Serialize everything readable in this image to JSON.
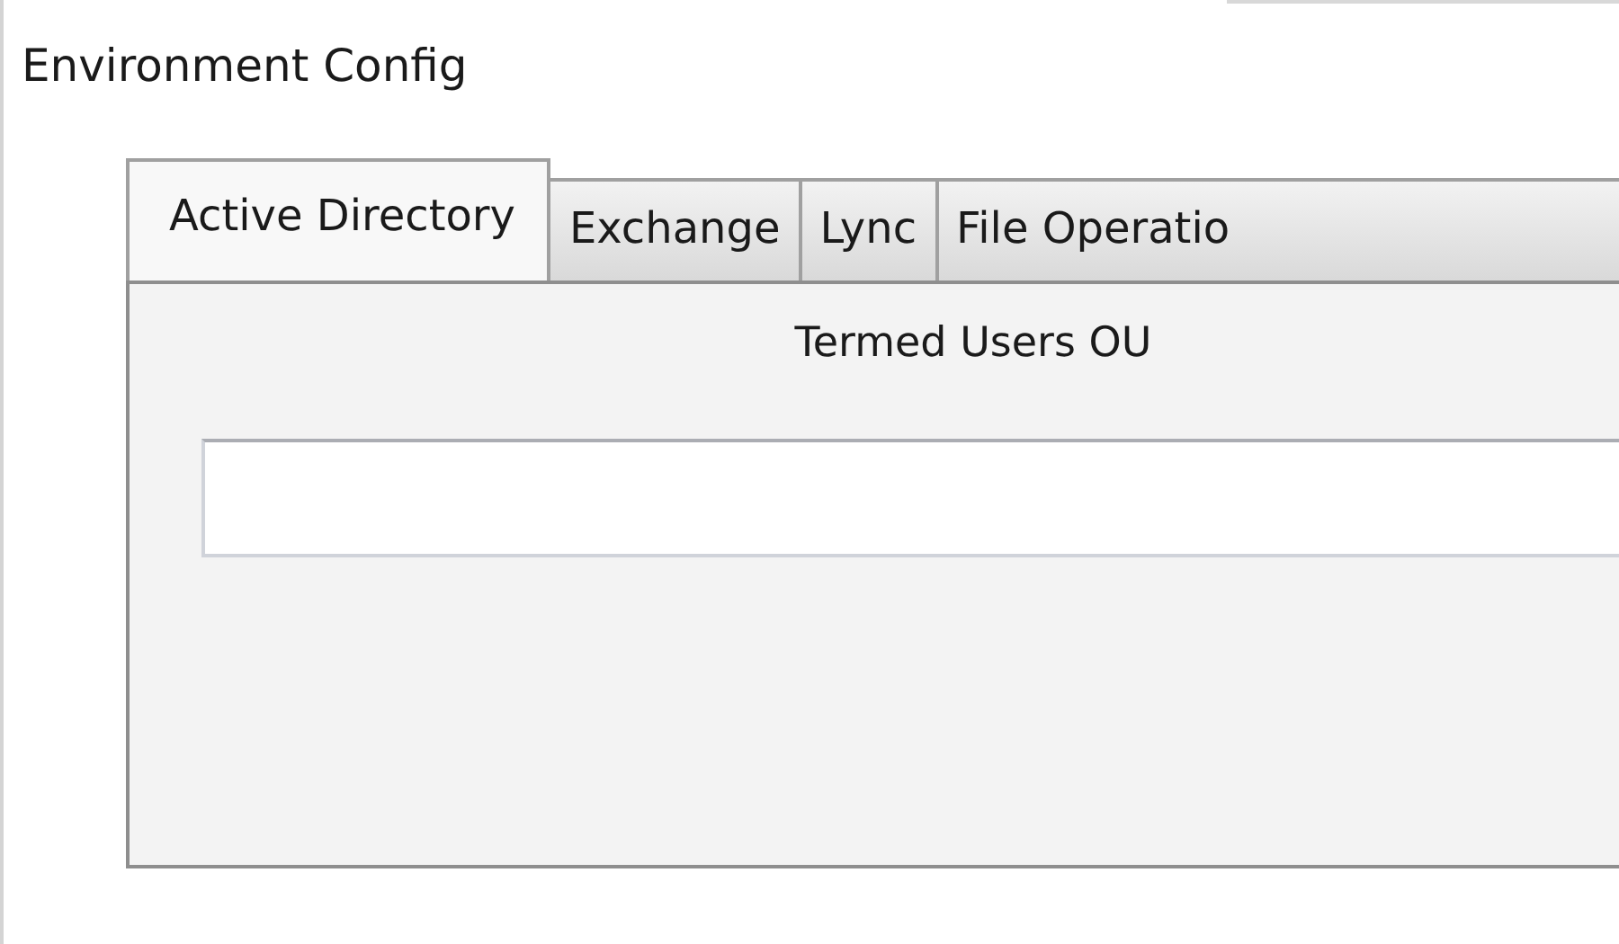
{
  "title": "Environment Config",
  "tabs": [
    {
      "label": "Active Directory",
      "selected": true
    },
    {
      "label": "Exchange",
      "selected": false
    },
    {
      "label": "Lync",
      "selected": false
    },
    {
      "label": "File Operatio",
      "selected": false
    }
  ],
  "panel": {
    "field_label": "Termed Users OU"
  }
}
